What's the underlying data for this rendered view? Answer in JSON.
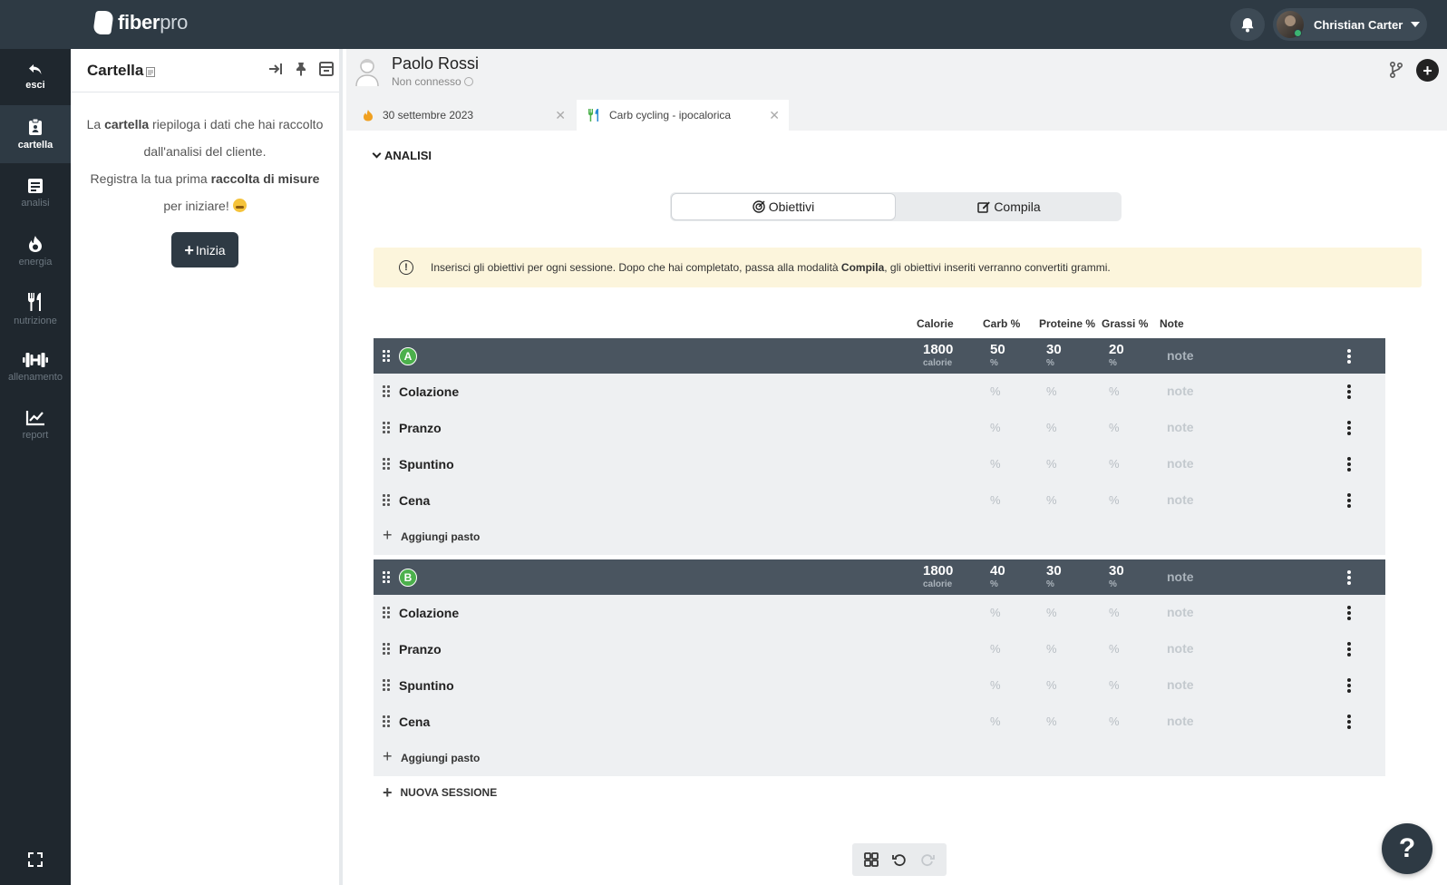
{
  "app": {
    "name_bold": "fiber",
    "name_light": "pro"
  },
  "header": {
    "user_name": "Christian Carter"
  },
  "nav": [
    {
      "id": "esci",
      "label": "esci",
      "icon": "undo-arrow-icon"
    },
    {
      "id": "cartella",
      "label": "cartella",
      "icon": "clipboard-icon"
    },
    {
      "id": "analisi",
      "label": "analisi",
      "icon": "document-icon"
    },
    {
      "id": "energia",
      "label": "energia",
      "icon": "flame-icon"
    },
    {
      "id": "nutrizione",
      "label": "nutrizione",
      "icon": "fork-knife-icon"
    },
    {
      "id": "allenamento",
      "label": "allenamento",
      "icon": "dumbbell-icon"
    },
    {
      "id": "report",
      "label": "report",
      "icon": "chart-line-icon"
    }
  ],
  "cartella": {
    "title": "Cartella",
    "text_1": "La ",
    "text_1_bold": "cartella",
    "text_2": " riepiloga i dati che hai raccolto dall'analisi del cliente.",
    "text_3": "Registra la tua prima ",
    "text_3_bold": "raccolta di misure",
    "text_4": " per iniziare!",
    "button": "Inizia"
  },
  "client": {
    "name": "Paolo Rossi",
    "status": "Non connesso"
  },
  "tabs": [
    {
      "label": "30 settembre 2023",
      "icon": "flame-icon",
      "active": false
    },
    {
      "label": "Carb cycling - ipocalorica",
      "icon": "fork-knife-icon",
      "active": true
    }
  ],
  "section": {
    "title": "ANALISI"
  },
  "mode": {
    "obiettivi": "Obiettivi",
    "compila": "Compila",
    "selected": "Obiettivi"
  },
  "info": {
    "text_before": "Inserisci gli obiettivi per ogni sessione. Dopo che hai completato, passa alla modalità ",
    "text_bold": "Compila",
    "text_after": ", gli obiettivi inseriti verranno convertiti grammi."
  },
  "columns": {
    "calorie": "Calorie",
    "carb": "Carb %",
    "proteine": "Proteine %",
    "grassi": "Grassi %",
    "note": "Note"
  },
  "sessions": [
    {
      "badge": "A",
      "calorie": "1800",
      "calorie_unit": "calorie",
      "carb": "50",
      "proteine": "30",
      "grassi": "20",
      "unit": "%",
      "note": "note",
      "meals": [
        {
          "name": "Colazione",
          "carb": "%",
          "proteine": "%",
          "grassi": "%",
          "note": "note"
        },
        {
          "name": "Pranzo",
          "carb": "%",
          "proteine": "%",
          "grassi": "%",
          "note": "note"
        },
        {
          "name": "Spuntino",
          "carb": "%",
          "proteine": "%",
          "grassi": "%",
          "note": "note"
        },
        {
          "name": "Cena",
          "carb": "%",
          "proteine": "%",
          "grassi": "%",
          "note": "note"
        }
      ],
      "add_meal": "Aggiungi pasto"
    },
    {
      "badge": "B",
      "calorie": "1800",
      "calorie_unit": "calorie",
      "carb": "40",
      "proteine": "30",
      "grassi": "30",
      "unit": "%",
      "note": "note",
      "meals": [
        {
          "name": "Colazione",
          "carb": "%",
          "proteine": "%",
          "grassi": "%",
          "note": "note"
        },
        {
          "name": "Pranzo",
          "carb": "%",
          "proteine": "%",
          "grassi": "%",
          "note": "note"
        },
        {
          "name": "Spuntino",
          "carb": "%",
          "proteine": "%",
          "grassi": "%",
          "note": "note"
        },
        {
          "name": "Cena",
          "carb": "%",
          "proteine": "%",
          "grassi": "%",
          "note": "note"
        }
      ],
      "add_meal": "Aggiungi pasto"
    }
  ],
  "new_session": "NUOVA SESSIONE",
  "help": "?",
  "colors": {
    "dark": "#2e3a44",
    "nav": "#1f272e",
    "session_row": "#4a5560",
    "badge": "#4cb04c",
    "info_bg": "#fcf5dc"
  }
}
